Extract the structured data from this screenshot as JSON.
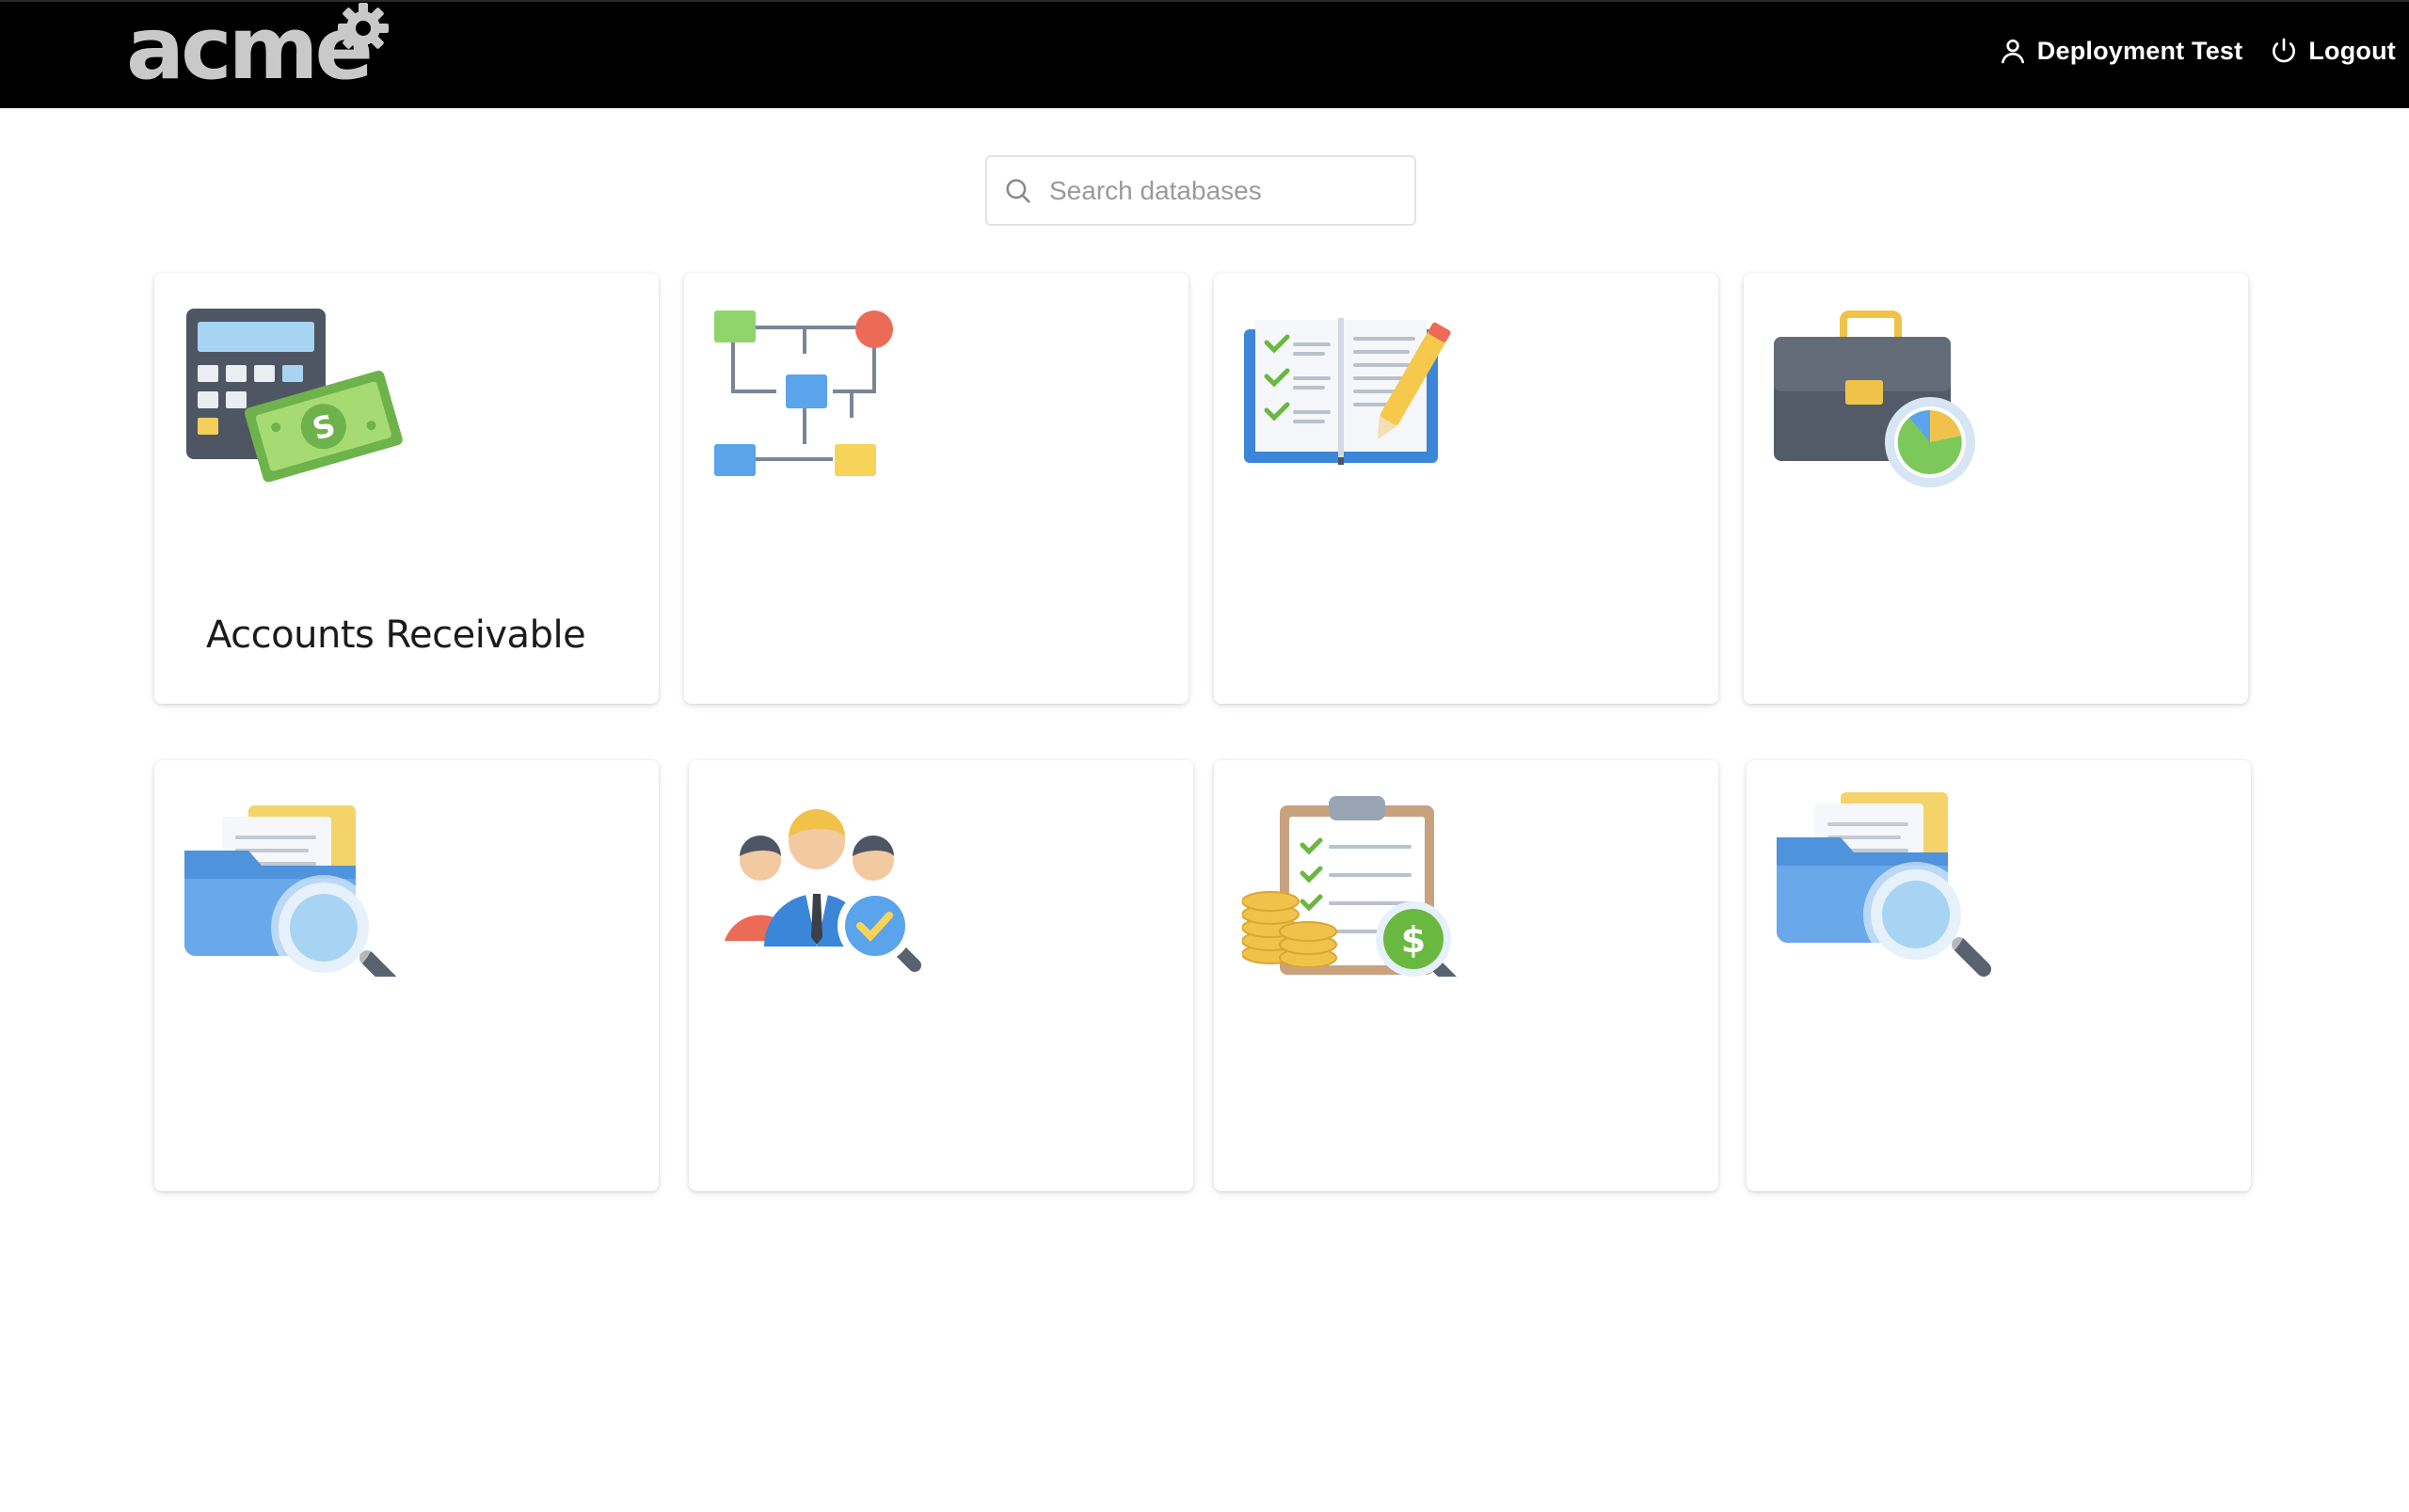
{
  "header": {
    "logo_text": "acme",
    "user_name": "Deployment Test",
    "logout_label": "Logout"
  },
  "search": {
    "placeholder": "Search databases",
    "value": ""
  },
  "databases": [
    {
      "label": "Accounts Receivable",
      "icon": "calculator-money-icon"
    },
    {
      "label": "",
      "icon": "flowchart-icon"
    },
    {
      "label": "",
      "icon": "checklist-book-icon"
    },
    {
      "label": "",
      "icon": "briefcase-chart-icon"
    },
    {
      "label": "",
      "icon": "folder-search-icon"
    },
    {
      "label": "",
      "icon": "team-approval-icon"
    },
    {
      "label": "",
      "icon": "clipboard-finance-icon"
    },
    {
      "label": "",
      "icon": "folder-search-icon"
    }
  ]
}
